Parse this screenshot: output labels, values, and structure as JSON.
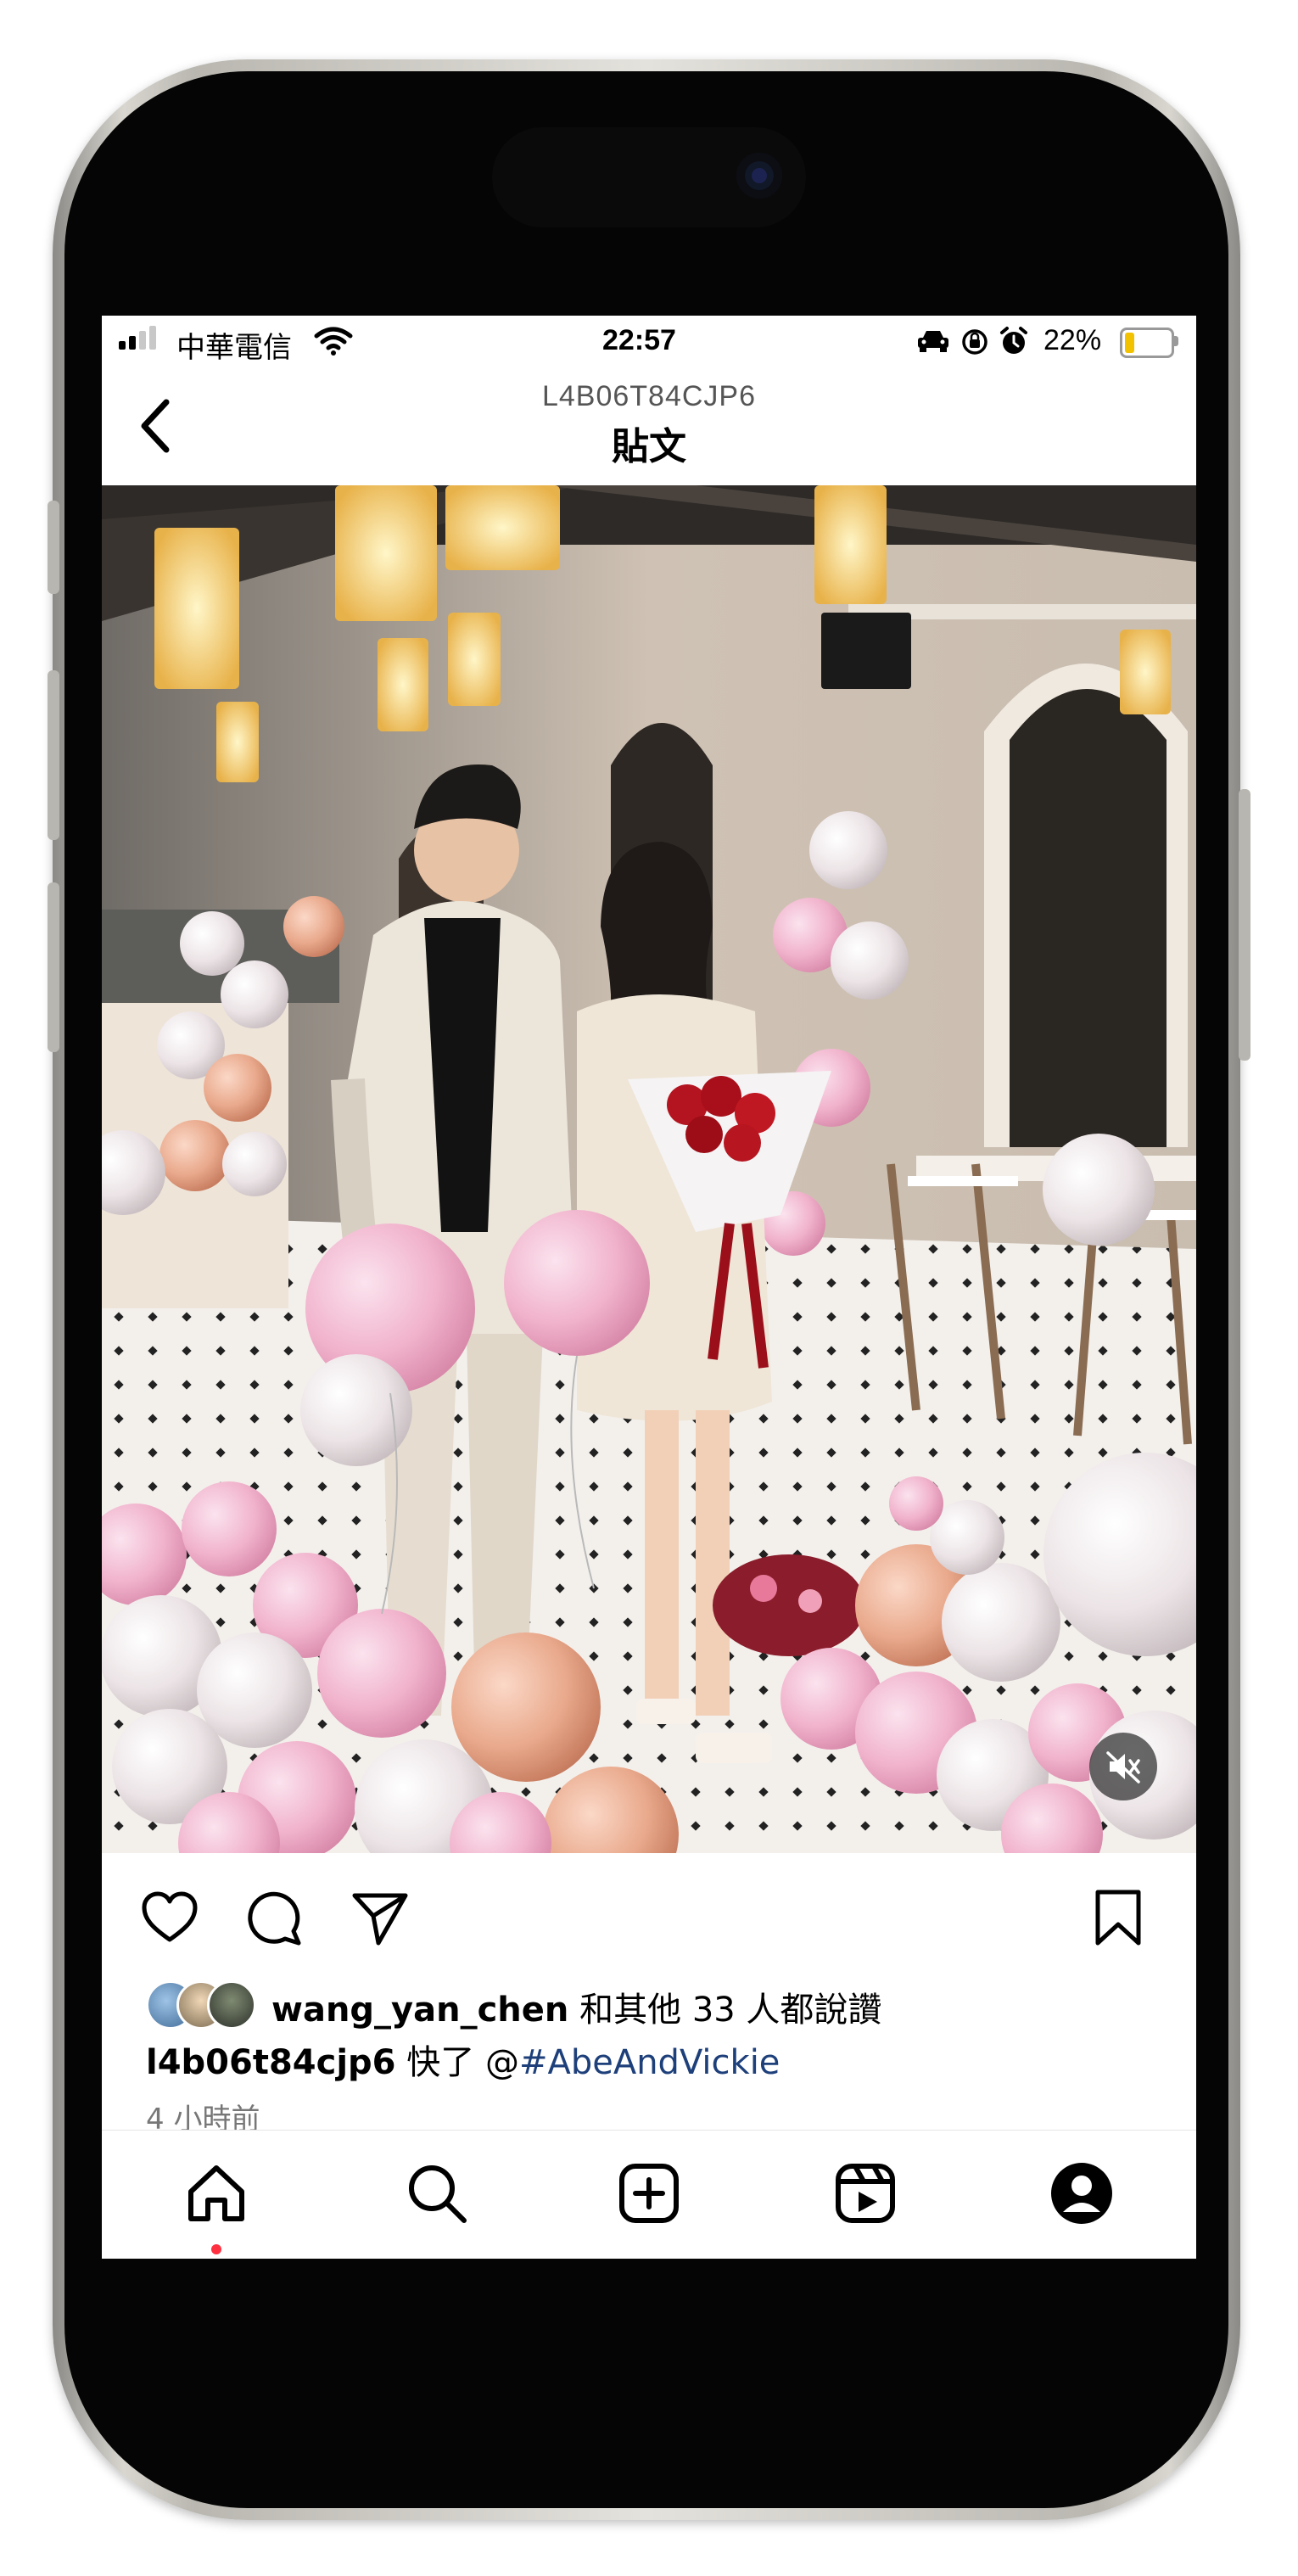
{
  "status_bar": {
    "carrier": "中華電信",
    "time": "22:57",
    "battery": "22%",
    "battery_level": 0.22,
    "icons": [
      "signal-icon",
      "wifi-icon",
      "car-mode-icon",
      "orientation-lock-icon",
      "alarm-icon",
      "battery-icon"
    ]
  },
  "header": {
    "account": "L4B06T84CJP6",
    "title": "貼文",
    "back_icon": "chevron-left-icon"
  },
  "post": {
    "image_description": "couple-with-balloons-photo",
    "mute_icon": "speaker-muted-icon",
    "actions": [
      "heart-icon",
      "comment-icon",
      "share-icon",
      "bookmark-icon"
    ],
    "liked_by_prefix_user": "wang_yan_chen",
    "liked_by_suffix": "和其他 33 人都說讚",
    "caption_user": "l4b06t84cjp6",
    "caption_text": "快了 @",
    "caption_hashtag": "#AbeAndVickie",
    "time_ago": "4 小時前"
  },
  "nav": {
    "items": [
      "home-icon",
      "search-icon",
      "create-icon",
      "reels-icon",
      "profile-icon"
    ],
    "active": "home-icon"
  }
}
